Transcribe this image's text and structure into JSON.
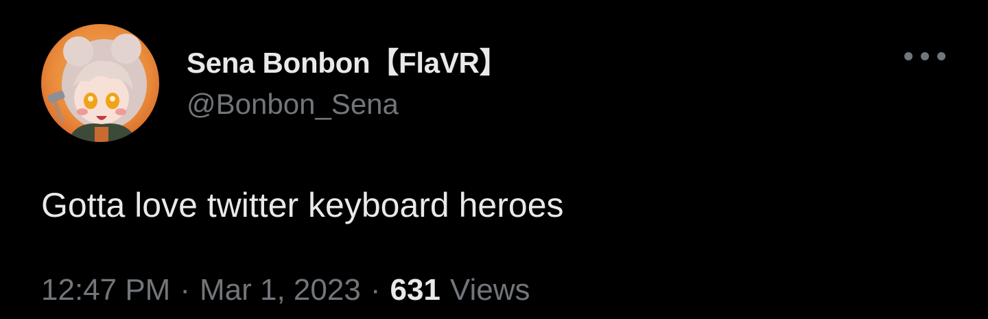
{
  "author": {
    "display_name": "Sena Bonbon【FlaVR】",
    "handle": "@Bonbon_Sena",
    "avatar_icon": "anime-avatar-icon"
  },
  "tweet": {
    "text": "Gotta love twitter keyboard heroes"
  },
  "meta": {
    "time": "12:47 PM",
    "separator": "·",
    "date": "Mar 1, 2023",
    "views_count": "631",
    "views_label": "Views"
  },
  "menu": {
    "icon": "more-options-icon"
  },
  "colors": {
    "background": "#000000",
    "primary_text": "#e7e9ea",
    "secondary_text": "#71767b"
  }
}
